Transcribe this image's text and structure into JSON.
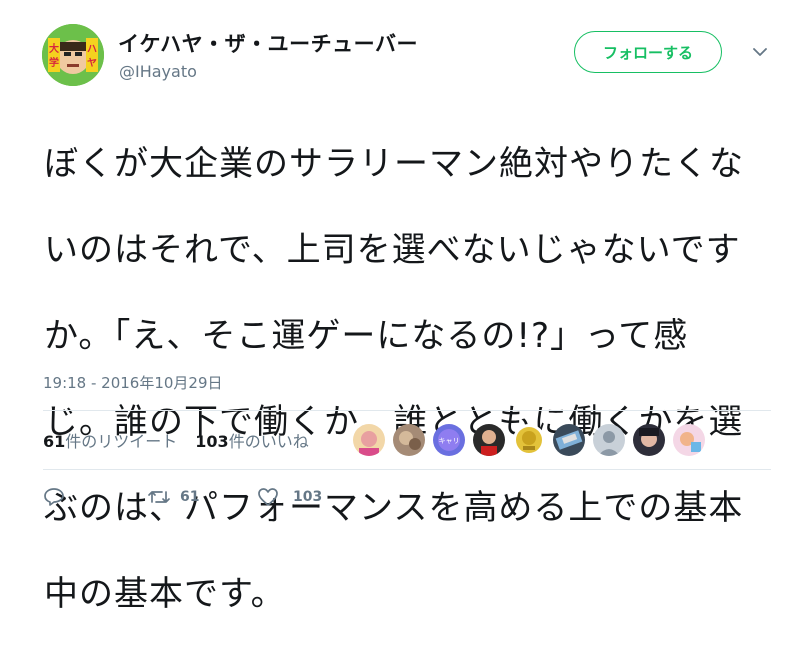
{
  "user": {
    "display_name": "イケハヤ・ザ・ユーチューバー",
    "handle": "@IHayato"
  },
  "follow_button": {
    "label": "フォローする"
  },
  "tweet": {
    "text_lines": [
      "ぼくが大企業のサラリーマン絶対やりたくな",
      "いのはそれで、上司を選べないじゃないです",
      "か。「え、そこ運ゲーになるの!?」って感",
      "じ。誰の下で働くか、誰とともに働くかを選",
      "ぶのは、パフォーマンスを高める上での基本",
      "中の基本です。"
    ],
    "timestamp": "19:18 - 2016年10月29日"
  },
  "stats": {
    "retweets_count": "61",
    "retweets_label": "件のリツイート",
    "likes_count": "103",
    "likes_label": "件のいいね"
  },
  "actions": {
    "retweet_count": "61",
    "like_count": "103"
  },
  "colors": {
    "follow_green": "#17bf63",
    "secondary_text": "#657786",
    "divider": "#e1e8ed"
  },
  "icons": [
    "caret-down-icon",
    "reply-icon",
    "retweet-icon",
    "heart-icon"
  ]
}
